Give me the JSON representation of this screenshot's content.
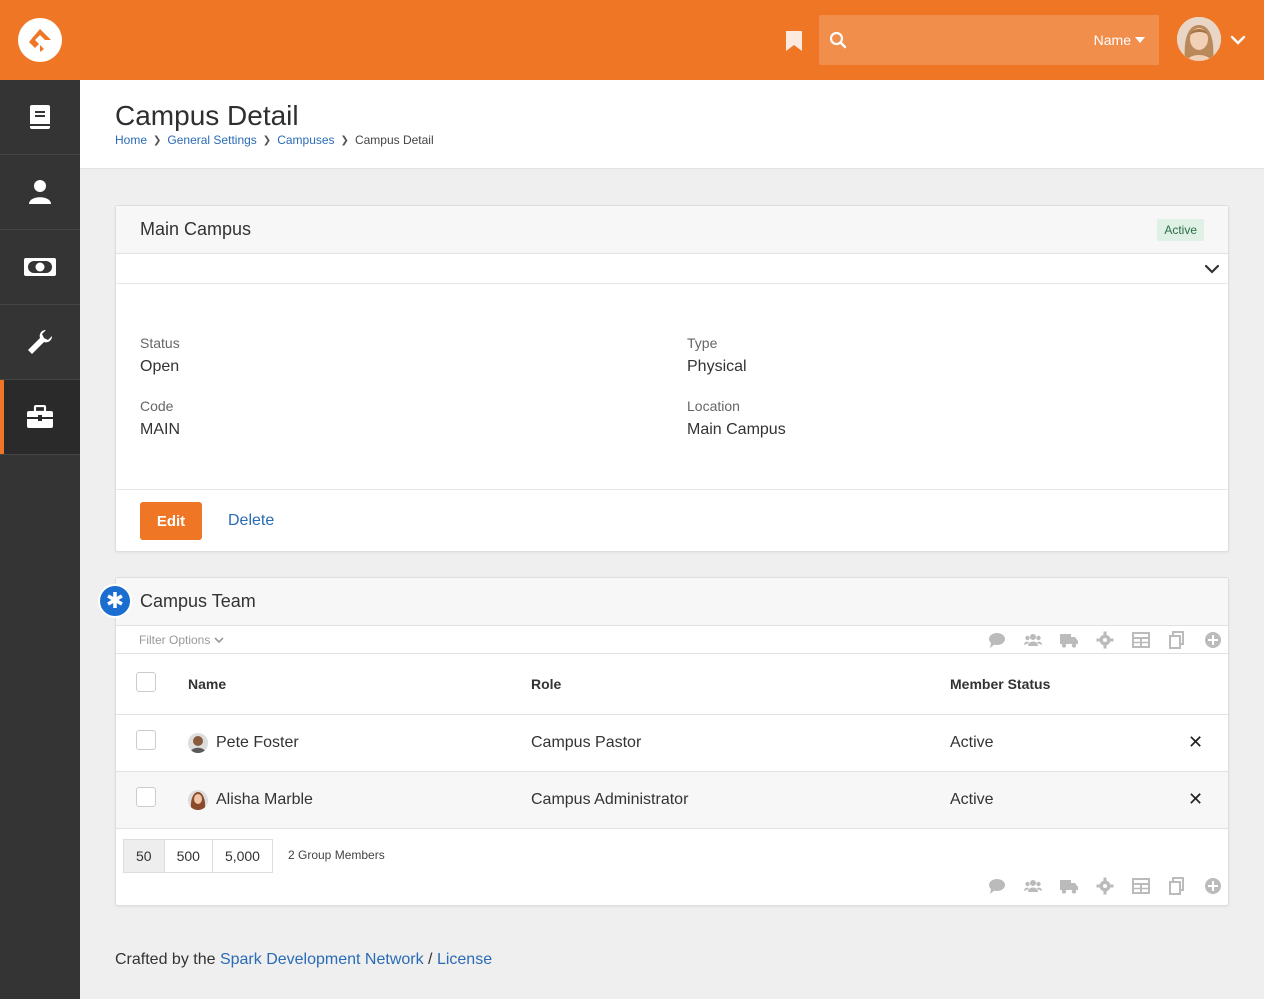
{
  "search": {
    "placeholder": "",
    "type_label": "Name"
  },
  "sidebar": {
    "items": [
      {
        "icon": "book-icon"
      },
      {
        "icon": "person-icon"
      },
      {
        "icon": "money-icon"
      },
      {
        "icon": "wrench-icon"
      },
      {
        "icon": "briefcase-icon",
        "active": true
      }
    ]
  },
  "header": {
    "title": "Campus Detail",
    "breadcrumb": [
      "Home",
      "General Settings",
      "Campuses",
      "Campus Detail"
    ]
  },
  "campus_panel": {
    "title": "Main Campus",
    "badge": "Active",
    "fields": {
      "status_label": "Status",
      "status_value": "Open",
      "type_label": "Type",
      "type_value": "Physical",
      "code_label": "Code",
      "code_value": "MAIN",
      "location_label": "Location",
      "location_value": "Main Campus"
    },
    "edit_label": "Edit",
    "delete_label": "Delete"
  },
  "team_panel": {
    "title": "Campus Team",
    "filter_label": "Filter Options",
    "columns": [
      "Name",
      "Role",
      "Member Status"
    ],
    "rows": [
      {
        "name": "Pete Foster",
        "role": "Campus Pastor",
        "status": "Active"
      },
      {
        "name": "Alisha Marble",
        "role": "Campus Administrator",
        "status": "Active"
      }
    ],
    "page_sizes": [
      "50",
      "500",
      "5,000"
    ],
    "member_count": "2 Group Members"
  },
  "footer": {
    "prefix": "Crafted by the",
    "link": "Spark Development Network",
    "sep": "/",
    "license": "License"
  },
  "colors": {
    "brand": "#ee7625",
    "sidebar": "#343434",
    "link": "#2a6bb4",
    "badge_bg": "#dff0e5"
  }
}
